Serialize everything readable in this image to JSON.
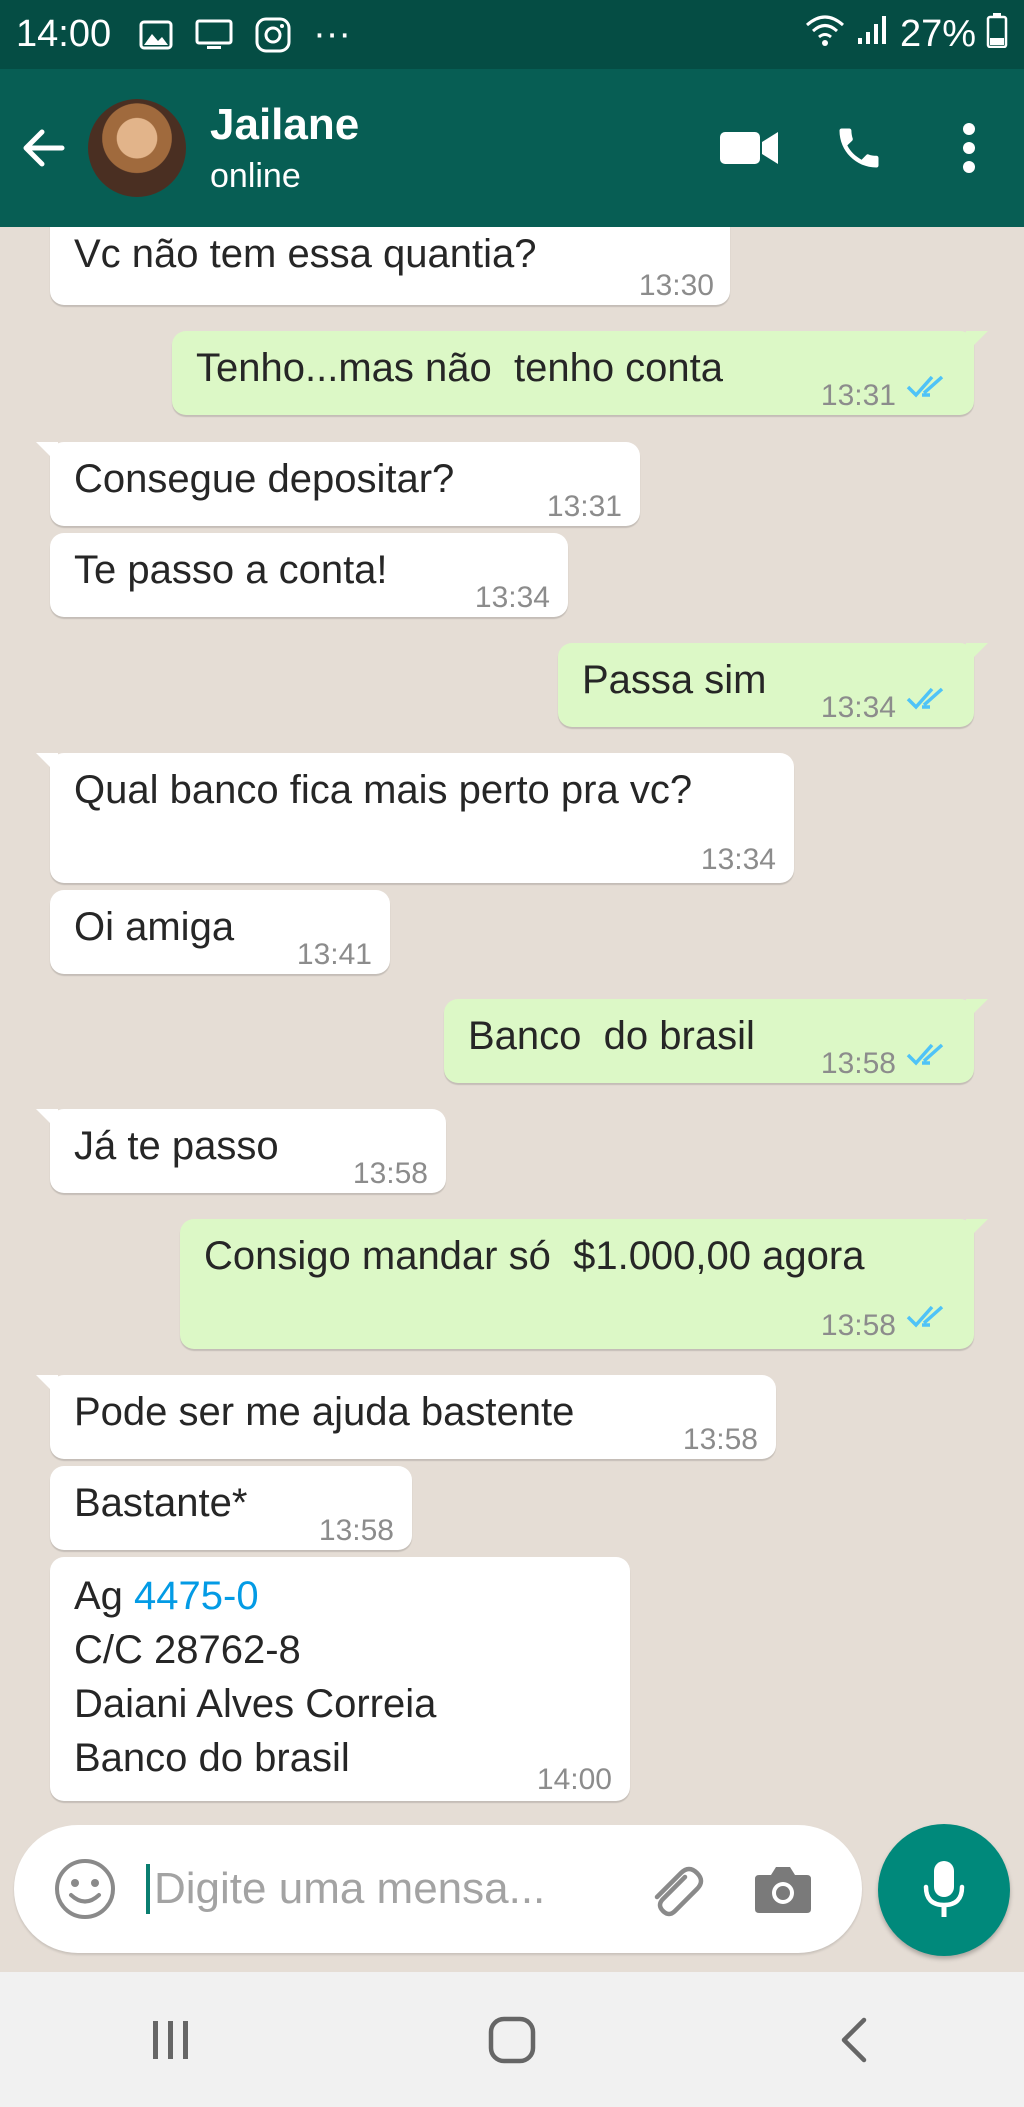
{
  "status_bar": {
    "time": "14:00",
    "left_icons": [
      "gallery-icon",
      "screen-icon",
      "instagram-icon",
      "more-notifications-icon"
    ],
    "more": "···",
    "battery": "27%"
  },
  "header": {
    "contact_name": "Jailane",
    "contact_status": "online",
    "colors": {
      "header": "#075e54",
      "status_bar": "#054d44"
    }
  },
  "messages": [
    {
      "dir": "in",
      "text": "Vc não tem essa quantia?",
      "time": "13:30"
    },
    {
      "dir": "out",
      "text": "Tenho...mas não  tenho conta",
      "time": "13:31",
      "read": true
    },
    {
      "dir": "in",
      "text": "Consegue depositar?",
      "time": "13:31"
    },
    {
      "dir": "in",
      "text": "Te passo a conta!",
      "time": "13:34"
    },
    {
      "dir": "out",
      "text": "Passa sim",
      "time": "13:34",
      "read": true
    },
    {
      "dir": "in",
      "text": "Qual banco fica mais perto pra vc?",
      "time": "13:34"
    },
    {
      "dir": "in",
      "text": "Oi amiga",
      "time": "13:41"
    },
    {
      "dir": "out",
      "text": "Banco  do brasil",
      "time": "13:58",
      "read": true
    },
    {
      "dir": "in",
      "text": "Já te passo",
      "time": "13:58"
    },
    {
      "dir": "out",
      "text": "Consigo mandar só  $1.000,00 agora",
      "time": "13:58",
      "read": true
    },
    {
      "dir": "in",
      "text": "Pode ser me ajuda bastente",
      "time": "13:58"
    },
    {
      "dir": "in",
      "text": "Bastante*",
      "time": "13:58"
    },
    {
      "dir": "in",
      "lines": {
        "ag_label": "Ag ",
        "ag_number": "4475-0",
        "line2": "C/C 28762-8",
        "line3": "Daiani Alves Correia",
        "line4": "Banco do brasil"
      },
      "time": "14:00"
    }
  ],
  "input": {
    "placeholder": "Digite uma mensa..."
  },
  "colors": {
    "chat_background": "#e5ddd5",
    "incoming_bubble": "#ffffff",
    "outgoing_bubble": "#dcf8c6",
    "read_ticks": "#4fc3f7",
    "link": "#039be5",
    "mic_button": "#00897b"
  }
}
